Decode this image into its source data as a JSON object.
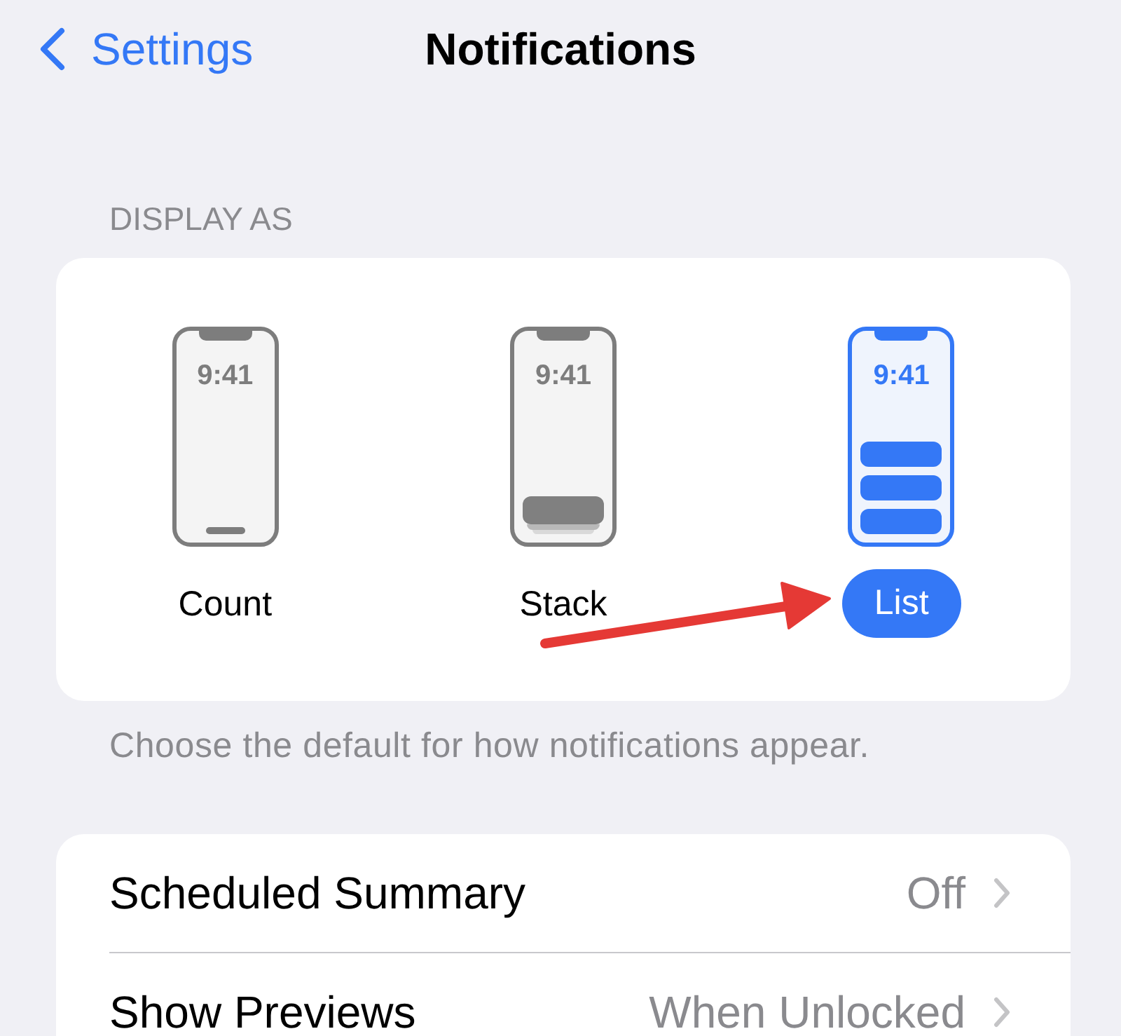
{
  "nav": {
    "back_label": "Settings",
    "title": "Notifications"
  },
  "display_as": {
    "header": "DISPLAY AS",
    "options": [
      {
        "kind": "count",
        "time": "9:41",
        "label": "Count",
        "selected": false
      },
      {
        "kind": "stack",
        "time": "9:41",
        "label": "Stack",
        "selected": false
      },
      {
        "kind": "list",
        "time": "9:41",
        "label": "List",
        "selected": true
      }
    ],
    "footer": "Choose the default for how notifications appear."
  },
  "settings": [
    {
      "label": "Scheduled Summary",
      "value": "Off"
    },
    {
      "label": "Show Previews",
      "value": "When Unlocked"
    }
  ]
}
